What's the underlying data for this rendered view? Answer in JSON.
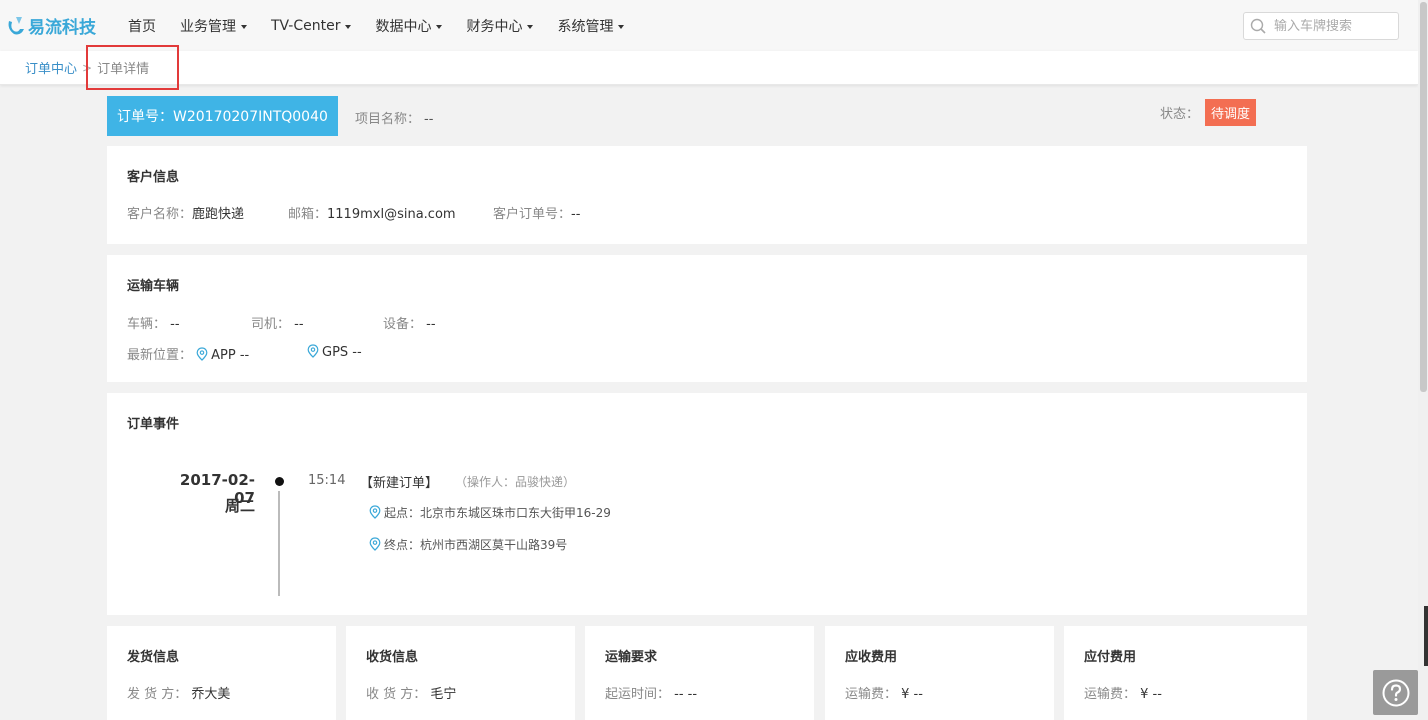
{
  "nav": {
    "logo_text": "易流科技",
    "menu": [
      {
        "label": "首页",
        "has_caret": false
      },
      {
        "label": "业务管理",
        "has_caret": true
      },
      {
        "label": "TV-Center",
        "has_caret": true
      },
      {
        "label": "数据中心",
        "has_caret": true
      },
      {
        "label": "财务中心",
        "has_caret": true
      },
      {
        "label": "系统管理",
        "has_caret": true
      }
    ],
    "search_placeholder": "输入车牌搜索"
  },
  "breadcrumb": {
    "parent": "订单中心",
    "separator": ">",
    "current": "订单详情"
  },
  "order": {
    "number_label": "订单号：W20170207INTQ0040",
    "project_label": "项目名称：",
    "project_value": "--",
    "status_label": "状态：",
    "status_value": "待调度"
  },
  "customer": {
    "title": "客户信息",
    "name_label": "客户名称：",
    "name_value": "鹿跑快递",
    "email_label": "邮箱：",
    "email_value": "1119mxl@sina.com",
    "order_no_label": "客户订单号：",
    "order_no_value": "--"
  },
  "vehicle": {
    "title": "运输车辆",
    "car_label": "车辆：",
    "car_value": "--",
    "driver_label": "司机：",
    "driver_value": "--",
    "device_label": "设备：",
    "device_value": "--",
    "location_label": "最新位置：",
    "app_text": "APP --",
    "gps_text": "GPS --"
  },
  "events": {
    "title": "订单事件",
    "date": "2017-02-07",
    "weekday": "周二",
    "time": "15:14",
    "event_name": "【新建订单】",
    "operator": "（操作人：品骏快递）",
    "origin": "起点：北京市东城区珠市口东大街甲16-29",
    "destination": "终点：杭州市西湖区莫干山路39号"
  },
  "bottom_cards": [
    {
      "title": "发货信息",
      "label": "发 货 方：",
      "value": "乔大美"
    },
    {
      "title": "收货信息",
      "label": "收 货 方：",
      "value": "毛宁"
    },
    {
      "title": "运输要求",
      "label": "起运时间：",
      "value": "-- --"
    },
    {
      "title": "应收费用",
      "label": "运输费：",
      "value": "¥ --"
    },
    {
      "title": "应付费用",
      "label": "运输费：",
      "value": "¥ --"
    }
  ],
  "colors": {
    "accent": "#3fb4e6",
    "status_badge": "#f36e52",
    "link": "#3a8fc8",
    "highlight_box": "#e23a3a"
  },
  "icons": [
    "logo-icon",
    "search-icon",
    "location-pin-icon",
    "help-icon",
    "chevron-down-icon"
  ]
}
